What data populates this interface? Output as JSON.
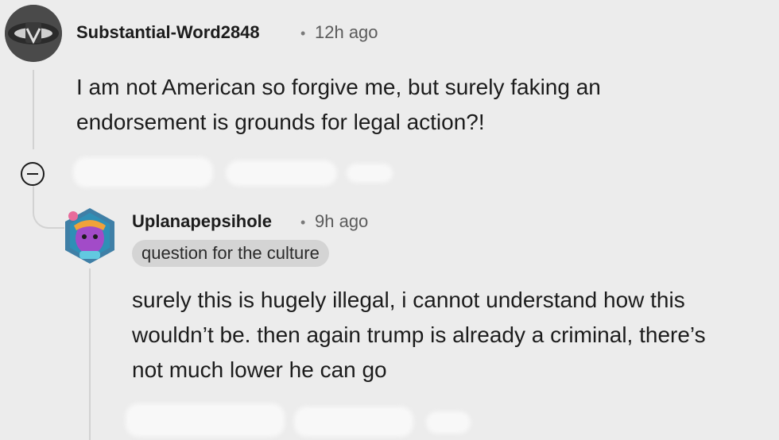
{
  "comments": [
    {
      "username": "Substantial-Word2848",
      "separator": "•",
      "time": "12h ago",
      "body_lines": [
        "I am not American so forgive me, but surely faking an",
        "endorsement is grounds for legal action?!"
      ]
    },
    {
      "username": "Uplanapepsihole",
      "separator": "•",
      "time": "9h ago",
      "flair": "question for the culture",
      "body_lines": [
        "surely this is hugely illegal, i cannot understand how this",
        "wouldn’t be. then again trump is already a criminal, there’s",
        "not much lower he can go"
      ]
    }
  ],
  "icons": {
    "collapse": "minus-circle-icon",
    "avatar1": "avatar-icon",
    "avatar2": "avatar-icon"
  },
  "colors": {
    "background": "#ececec",
    "thread_line": "#d2d2d2",
    "flair_bg": "#d4d4d4",
    "avatar2_purple": "#a24bc8"
  }
}
